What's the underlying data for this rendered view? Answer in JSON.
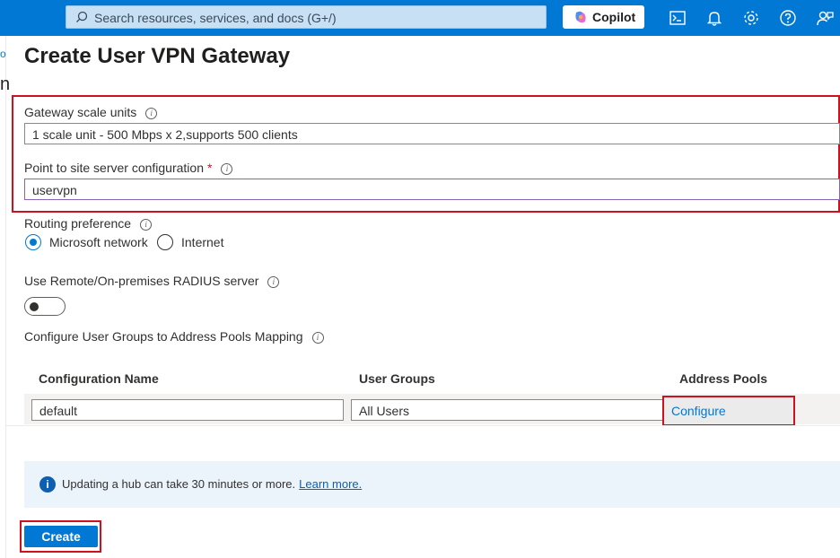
{
  "topbar": {
    "search_placeholder": "Search resources, services, and docs (G+/)",
    "copilot_label": "Copilot",
    "icons": [
      "cloud-shell-icon",
      "bell-icon",
      "gear-icon",
      "help-icon",
      "feedback-icon"
    ]
  },
  "left_fragments": {
    "frag1": "o",
    "frag2": "n"
  },
  "page": {
    "title": "Create User VPN Gateway"
  },
  "form": {
    "gateway_scale_units_label": "Gateway scale units",
    "gateway_scale_units_value": "1 scale unit - 500 Mbps x 2,supports 500 clients",
    "p2s_config_label": "Point to site server configuration",
    "required_marker": "*",
    "p2s_config_value": "uservpn",
    "routing_preference_label": "Routing preference",
    "routing_options": [
      "Microsoft network",
      "Internet"
    ],
    "routing_selected": "Microsoft network",
    "radius_label": "Use Remote/On-premises RADIUS server",
    "radius_enabled": false,
    "mapping_label": "Configure User Groups to Address Pools Mapping"
  },
  "mapping_table": {
    "headers": [
      "Configuration Name",
      "User Groups",
      "Address Pools"
    ],
    "rows": [
      {
        "configuration_name": "default",
        "user_groups": "All Users",
        "address_pools_link": "Configure"
      }
    ]
  },
  "info_bar": {
    "message": "Updating a hub can take 30 minutes or more.",
    "link": "Learn more."
  },
  "actions": {
    "create_label": "Create"
  },
  "colors": {
    "accent": "#0078d4",
    "highlight": "#d1101f",
    "topbar": "#0078d4"
  }
}
